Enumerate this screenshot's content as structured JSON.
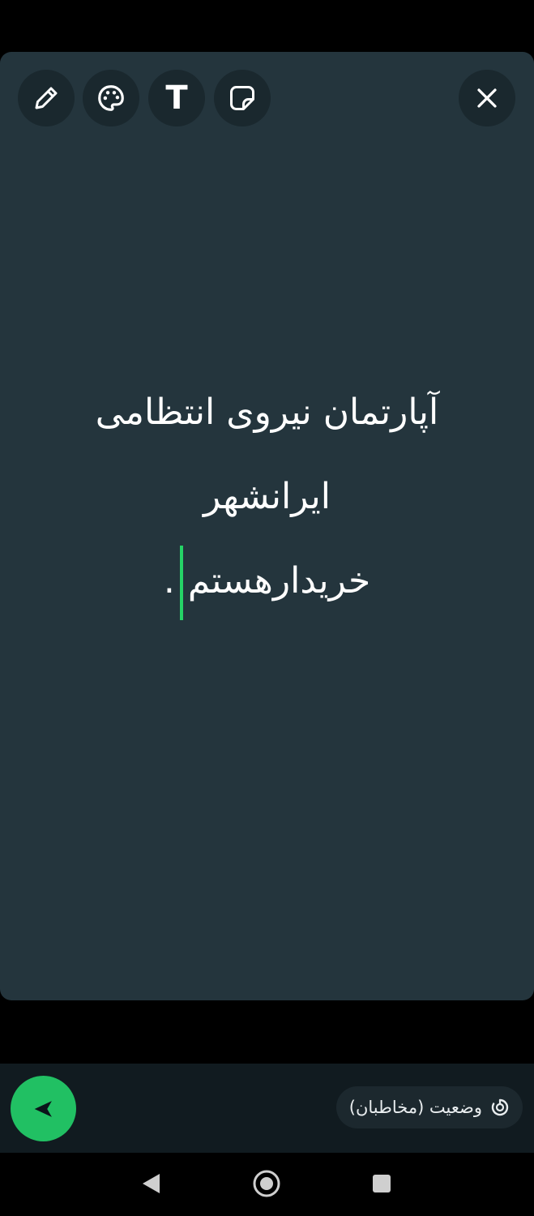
{
  "toolbar": {
    "icons": [
      "pencil-icon",
      "palette-icon",
      "text-icon",
      "sticker-icon",
      "close-icon"
    ],
    "text_tool_label": "T"
  },
  "status_text": {
    "lines": [
      "آپارتمان نیروی انتظامی",
      "ایرانشهر",
      "خریدارهستم",
      "."
    ]
  },
  "bottom": {
    "audience_label": "وضعیت (مخاطبان)",
    "send_icon": "send-icon",
    "audience_icon": "status-ring-icon"
  },
  "nav": {
    "icons": [
      "back-triangle-icon",
      "home-circle-icon",
      "recents-square-icon"
    ]
  },
  "colors": {
    "canvas_background": "#24353d",
    "accent": "#21c063",
    "cursor": "#25d366"
  }
}
